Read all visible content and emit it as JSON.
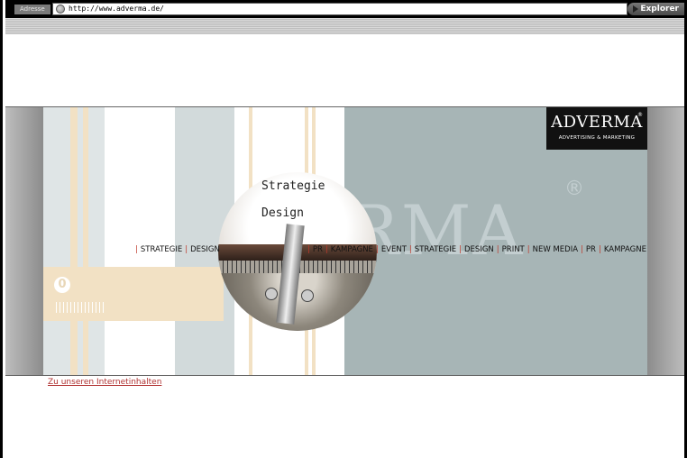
{
  "browser": {
    "address_label": "Adresse",
    "url": "http://www.adverma.de/",
    "go_button_label": "Explorer"
  },
  "banner": {
    "logo_word": "ADVERMA",
    "logo_sub": "ADVERTISING & MARKETING",
    "logo_reg": "®",
    "big_logo": "ERMA",
    "big_reg": "®",
    "zero_glyph": "0",
    "circle_text": [
      "Strategie",
      "Design"
    ],
    "menu_left": [
      "STRATEGIE",
      "DESIGN"
    ],
    "menu_right": [
      "PR",
      "KAMPAGNE",
      "EVENT",
      "STRATEGIE",
      "DESIGN",
      "PRINT",
      "NEW MEDIA",
      "PR",
      "KAMPAGNE"
    ],
    "colors": {
      "panel": "#a7b5b6",
      "beige": "#f2e1c4",
      "accent_separator": "#c0392b",
      "logo_box": "#111111"
    }
  },
  "content": {
    "enter_link": "Zu unseren Internetinhalten"
  }
}
